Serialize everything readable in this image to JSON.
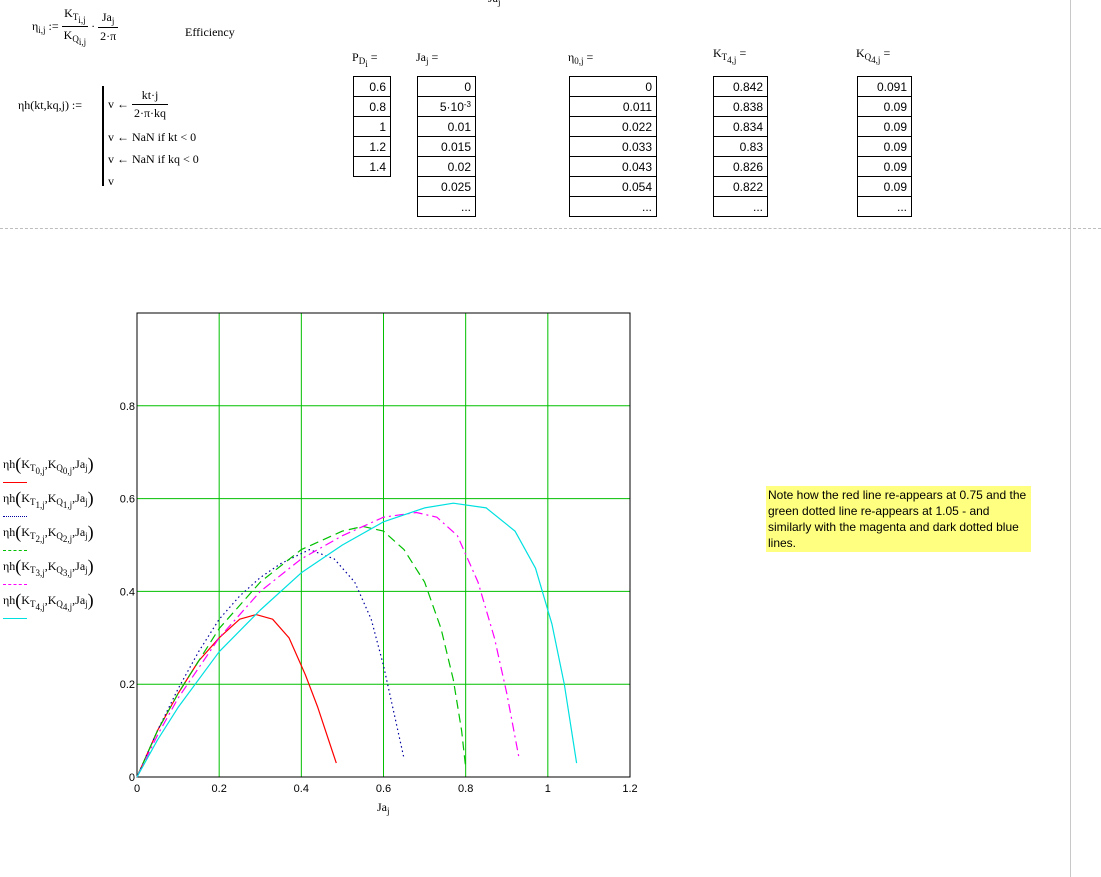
{
  "top_cut_text": "Ja",
  "efficiency_def": {
    "lhs": "η",
    "lhs_sub": "i,j",
    "assign": ":=",
    "num1_base": "K",
    "num1_sub": "T",
    "num1_subsub": "i,j",
    "den1_base": "K",
    "den1_sub": "Q",
    "den1_subsub": "i,j",
    "num2_base": "Ja",
    "num2_sub": "j",
    "den2": "2·π",
    "dot": "·"
  },
  "efficiency_label": "Efficiency",
  "eta_h_def": {
    "lhs": "ηh(kt,kq,j) :=",
    "line1_lhs": "v ←",
    "line1_num": "kt·j",
    "line1_den": "2·π·kq",
    "line2": "v ← NaN  if  kt < 0",
    "line3": "v ← NaN  if  kq < 0",
    "line4": "v"
  },
  "tables": {
    "pd": {
      "label": "P",
      "label_sub": "D",
      "label_subsub": "i",
      "eq": "=",
      "values": [
        "0.6",
        "0.8",
        "1",
        "1.2",
        "1.4"
      ]
    },
    "ja": {
      "label": "Ja",
      "label_sub": "j",
      "eq": "=",
      "values": [
        "0",
        "5·10",
        "0.01",
        "0.015",
        "0.02",
        "0.025",
        "..."
      ],
      "exp": "-3"
    },
    "eta": {
      "label": "η",
      "label_sub": "0,j",
      "eq": "=",
      "values": [
        "0",
        "0.011",
        "0.022",
        "0.033",
        "0.043",
        "0.054",
        "..."
      ]
    },
    "kt": {
      "label": "K",
      "label_sub": "T",
      "label_subsub": "4,j",
      "eq": "=",
      "values": [
        "0.842",
        "0.838",
        "0.834",
        "0.83",
        "0.826",
        "0.822",
        "..."
      ]
    },
    "kq": {
      "label": "K",
      "label_sub": "Q",
      "label_subsub": "4,j",
      "eq": "=",
      "values": [
        "0.091",
        "0.09",
        "0.09",
        "0.09",
        "0.09",
        "0.09",
        "..."
      ]
    }
  },
  "legend": [
    {
      "i": "0",
      "color": "#ff0000",
      "dash": "solid"
    },
    {
      "i": "1",
      "color": "#0000a0",
      "dash": "dotted"
    },
    {
      "i": "2",
      "color": "#00c000",
      "dash": "dashed"
    },
    {
      "i": "3",
      "color": "#ff00ff",
      "dash": "dashdot"
    },
    {
      "i": "4",
      "color": "#00e0e0",
      "dash": "solid"
    }
  ],
  "legend_text": {
    "fn": "ηh",
    "kt": "K",
    "kt_sub": "T",
    "kq": "K",
    "kq_sub": "Q",
    "ja": "Ja",
    "ja_sub": "j",
    "j": "j"
  },
  "note": "Note how the red line re-appears at 0.75 and the green dotted line re-appears at 1.05 - and similarly with the magenta and dark dotted blue lines.",
  "chart_data": {
    "type": "line",
    "xlabel": "Ja",
    "xlabel_sub": "j",
    "xlim": [
      0,
      1.2
    ],
    "ylim": [
      0,
      1
    ],
    "xticks": [
      "0",
      "0.2",
      "0.4",
      "0.6",
      "0.8",
      "1",
      "1.2"
    ],
    "yticks": [
      "0",
      "0.2",
      "0.4",
      "0.6",
      "0.8"
    ],
    "grid": true,
    "grid_color": "#00c000",
    "series": [
      {
        "color": "#ff0000",
        "dash": "solid",
        "x": [
          0,
          0.05,
          0.1,
          0.15,
          0.2,
          0.25,
          0.29,
          0.33,
          0.37,
          0.41,
          0.44,
          0.47,
          0.485
        ],
        "y": [
          0,
          0.1,
          0.18,
          0.25,
          0.3,
          0.34,
          0.35,
          0.34,
          0.3,
          0.22,
          0.15,
          0.07,
          0.03
        ]
      },
      {
        "color": "#0000a0",
        "dash": "dotted",
        "x": [
          0,
          0.05,
          0.1,
          0.15,
          0.2,
          0.25,
          0.3,
          0.35,
          0.42,
          0.48,
          0.53,
          0.57,
          0.6,
          0.63,
          0.65
        ],
        "y": [
          0,
          0.1,
          0.19,
          0.27,
          0.34,
          0.39,
          0.43,
          0.46,
          0.49,
          0.47,
          0.42,
          0.34,
          0.24,
          0.12,
          0.04
        ]
      },
      {
        "color": "#00c000",
        "dash": "dashed",
        "x": [
          0,
          0.05,
          0.1,
          0.2,
          0.3,
          0.4,
          0.5,
          0.55,
          0.6,
          0.65,
          0.7,
          0.74,
          0.77,
          0.79,
          0.8
        ],
        "y": [
          0,
          0.1,
          0.18,
          0.32,
          0.42,
          0.49,
          0.53,
          0.54,
          0.53,
          0.49,
          0.42,
          0.32,
          0.21,
          0.1,
          0.02
        ]
      },
      {
        "color": "#ff00ff",
        "dash": "dashdot",
        "x": [
          0,
          0.05,
          0.1,
          0.2,
          0.3,
          0.4,
          0.5,
          0.6,
          0.68,
          0.73,
          0.78,
          0.83,
          0.87,
          0.9,
          0.93
        ],
        "y": [
          0,
          0.09,
          0.17,
          0.3,
          0.4,
          0.47,
          0.52,
          0.56,
          0.57,
          0.56,
          0.52,
          0.42,
          0.3,
          0.18,
          0.04
        ]
      },
      {
        "color": "#00e0e0",
        "dash": "solid",
        "x": [
          0,
          0.05,
          0.1,
          0.2,
          0.3,
          0.4,
          0.5,
          0.6,
          0.7,
          0.77,
          0.85,
          0.92,
          0.97,
          1.01,
          1.04,
          1.07
        ],
        "y": [
          0,
          0.08,
          0.15,
          0.27,
          0.36,
          0.44,
          0.5,
          0.55,
          0.58,
          0.59,
          0.58,
          0.53,
          0.45,
          0.33,
          0.2,
          0.03
        ]
      }
    ]
  }
}
